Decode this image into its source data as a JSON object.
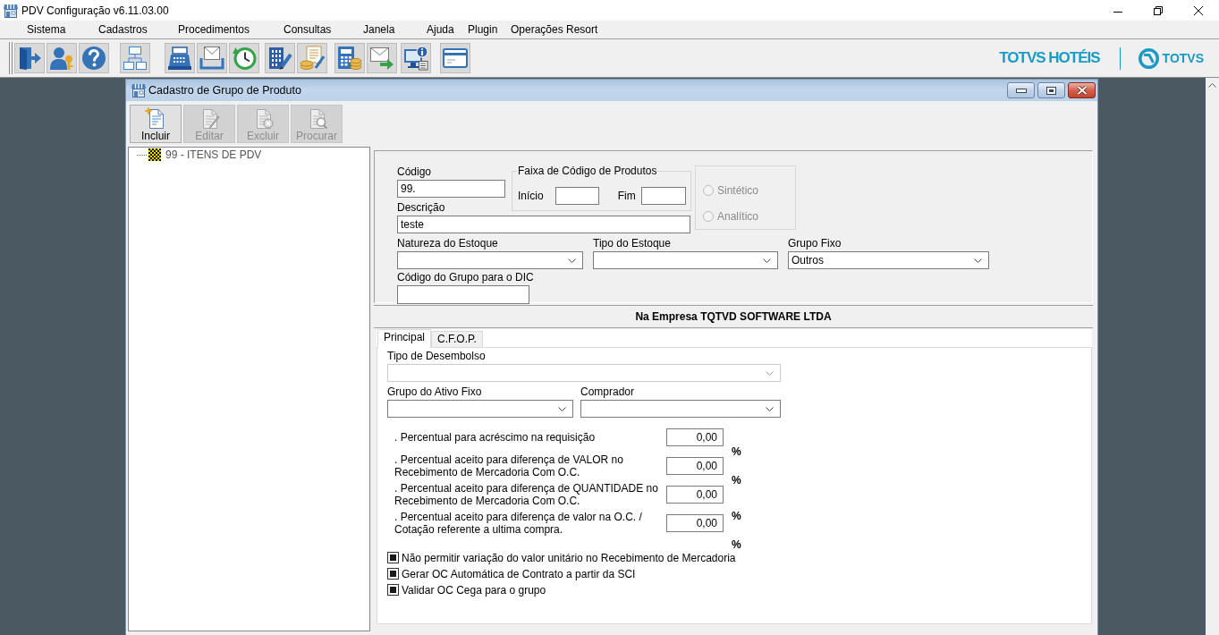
{
  "window": {
    "title": "PDV Configuração v6.11.03.00"
  },
  "menu": [
    "Sistema",
    "Cadastros",
    "Procedimentos",
    "Consultas",
    "Janela",
    "Ajuda",
    "Plugin",
    "Operações Resort"
  ],
  "brand": {
    "product": "TOTVS HOTÉIS",
    "company": "TOTVS"
  },
  "child_window": {
    "title": "Cadastro de Grupo de Produto",
    "toolbar": [
      {
        "label": "Incluir",
        "kind": "create",
        "disabled": false
      },
      {
        "label": "Editar",
        "kind": "edit",
        "disabled": true
      },
      {
        "label": "Excluir",
        "kind": "delete",
        "disabled": true
      },
      {
        "label": "Procurar",
        "kind": "search",
        "disabled": true
      }
    ],
    "tree": [
      {
        "label": "99 - ITENS DE PDV"
      }
    ],
    "form": {
      "code": {
        "label": "Código",
        "value": "99."
      },
      "code_range": {
        "title": "Faixa de Código de Produtos",
        "start_label": "Início",
        "end_label": "Fim"
      },
      "type_options": [
        {
          "label": "Sintético",
          "selected": false,
          "disabled": true
        },
        {
          "label": "Analítico",
          "selected": false,
          "disabled": true
        }
      ],
      "description": {
        "label": "Descrição",
        "value": "teste"
      },
      "selects": [
        {
          "label": "Natureza do Estoque",
          "disabled": false
        },
        {
          "label": "Tipo do Estoque",
          "disabled": false
        },
        {
          "label": "Grupo Fixo",
          "value": "Outros",
          "disabled": false
        }
      ],
      "dic_code": {
        "label": "Código do Grupo para o DIC"
      }
    },
    "company_header": "Na Empresa TQTVD SOFTWARE LTDA",
    "tabs": [
      {
        "label": "Principal",
        "selected": true
      },
      {
        "label": "C.F.O.P.",
        "selected": false
      }
    ],
    "principal": {
      "disbursement_type": {
        "label": "Tipo de Desembolso",
        "disabled": true
      },
      "selects": [
        {
          "label": "Grupo do Ativo Fixo",
          "disabled": false
        },
        {
          "label": "Comprador",
          "disabled": false
        }
      ],
      "percentages": [
        {
          "label": ". Percentual para acréscimo na requisição",
          "value": "0,00",
          "unit": "%"
        },
        {
          "label": ". Percentual aceito para diferença de VALOR no Recebimento de Mercadoria Com O.C.",
          "value": "0,00",
          "unit": "%"
        },
        {
          "label": ". Percentual aceito para diferença de QUANTIDADE no Recebimento de Mercadoria Com O.C.",
          "value": "0,00",
          "unit": "%"
        },
        {
          "label": ". Percentual aceito para diferença de valor na O.C. / Cotação referente a ultima compra.",
          "value": "0,00",
          "unit": "%"
        }
      ],
      "checkboxes": [
        {
          "label": "Não permitir variação do valor unitário no Recebimento de Mercadoria",
          "checked": true
        },
        {
          "label": "Gerar OC Automática de Contrato a partir da SCI",
          "checked": true
        },
        {
          "label": "Validar OC Cega para o grupo",
          "checked": true
        }
      ]
    }
  }
}
